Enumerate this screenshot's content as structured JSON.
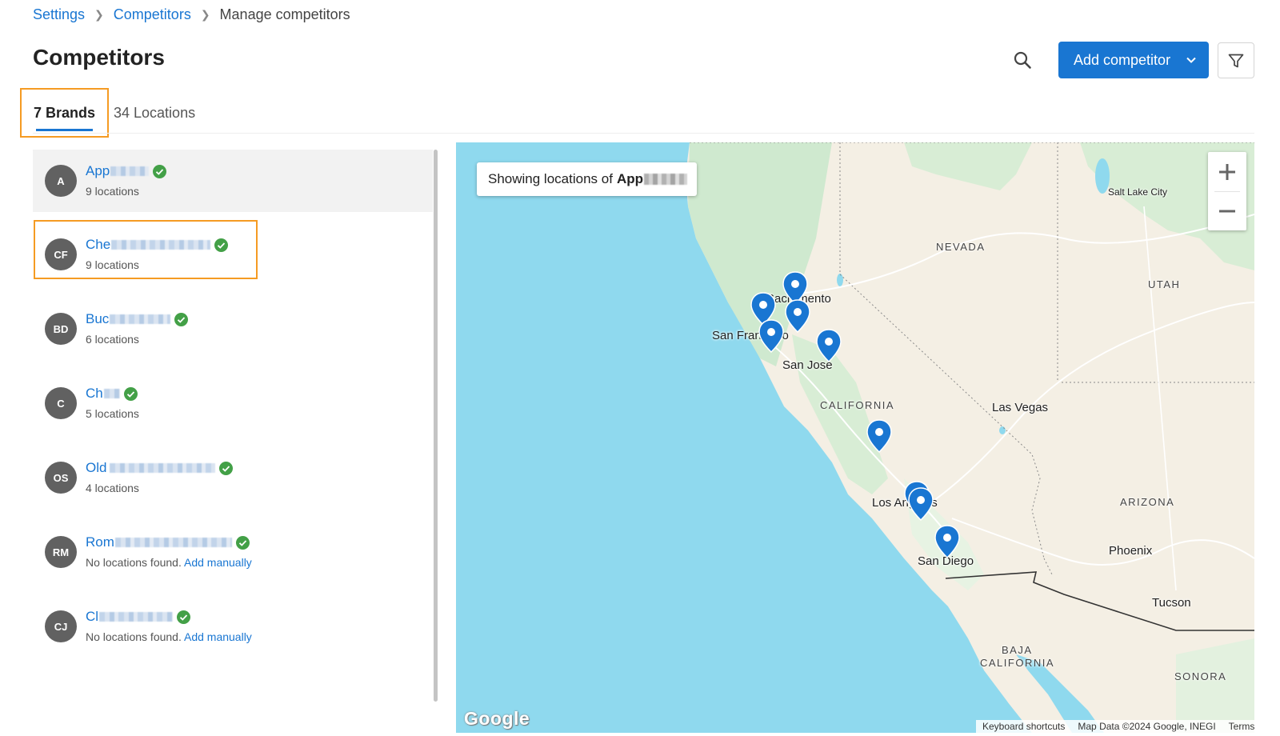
{
  "breadcrumb": {
    "settings": "Settings",
    "competitors": "Competitors",
    "current": "Manage competitors"
  },
  "page": {
    "title": "Competitors",
    "add_button": "Add competitor"
  },
  "tabs": {
    "brands": "7 Brands",
    "locations": "34 Locations"
  },
  "brands": [
    {
      "initials": "A",
      "name": "App",
      "sub": "9 locations",
      "add_link": ""
    },
    {
      "initials": "CF",
      "name": "Che",
      "sub": "9 locations",
      "add_link": ""
    },
    {
      "initials": "BD",
      "name": "Buc",
      "sub": "6 locations",
      "add_link": ""
    },
    {
      "initials": "C",
      "name": "Ch",
      "sub": "5 locations",
      "add_link": ""
    },
    {
      "initials": "OS",
      "name": "Old",
      "sub": "4 locations",
      "add_link": ""
    },
    {
      "initials": "RM",
      "name": "Rom",
      "sub": "No locations found.",
      "add_link": "Add manually"
    },
    {
      "initials": "CJ",
      "name": "Cl",
      "sub": "No locations found.",
      "add_link": "Add manually"
    }
  ],
  "map": {
    "banner_prefix": "Showing locations of",
    "banner_brand": "App",
    "labels": {
      "salt_lake_city": "Salt Lake City",
      "nevada": "NEVADA",
      "utah": "UTAH",
      "sacramento": "Sacramento",
      "san_francisco": "San Francisco",
      "san_jose": "San Jose",
      "california": "CALIFORNIA",
      "las_vegas": "Las Vegas",
      "los_angeles": "Los Angeles",
      "arizona": "ARIZONA",
      "san_diego": "San Diego",
      "phoenix": "Phoenix",
      "tucson": "Tucson",
      "baja": "BAJA",
      "baja_california": "CALIFORNIA",
      "sonora": "SONORA"
    },
    "logo": "Google",
    "footer": {
      "shortcuts": "Keyboard shortcuts",
      "data": "Map Data ©2024 Google, INEGI",
      "terms": "Terms"
    }
  },
  "colors": {
    "accent": "#1976d2",
    "highlight": "#f59b23",
    "verified": "#43a047",
    "avatar": "#616161",
    "water": "#8fd9ee",
    "land": "#f4efe4",
    "green": "#cfe9cf"
  }
}
